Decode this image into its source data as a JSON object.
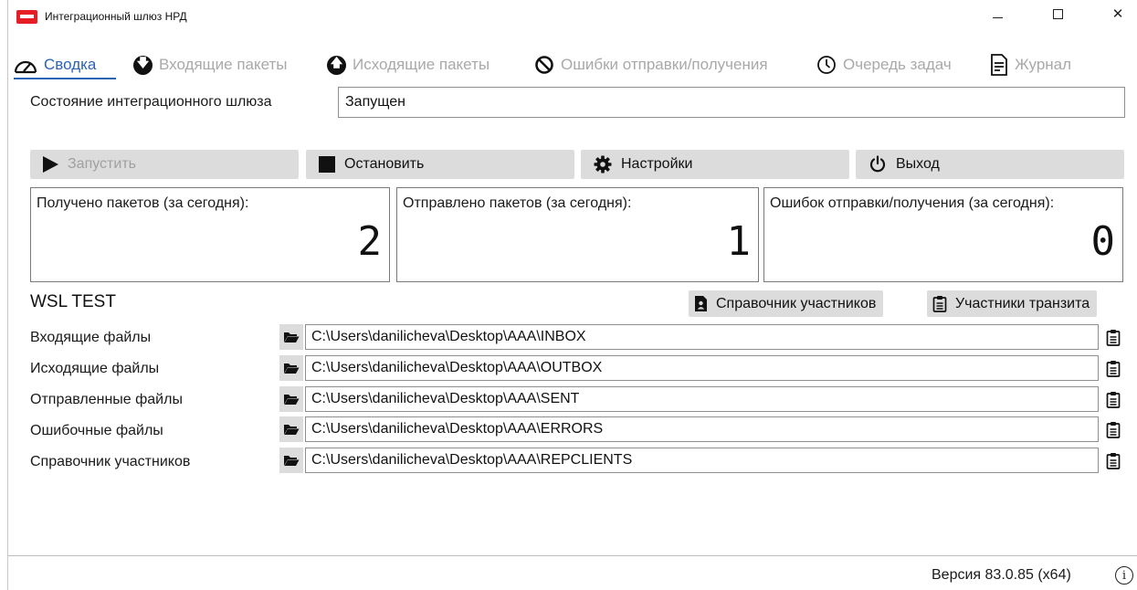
{
  "window": {
    "title": "Интеграционный шлюз НРД",
    "minimize_icon": "minimize-icon",
    "maximize_icon": "maximize-icon",
    "close_glyph": "✕"
  },
  "tabs": [
    {
      "label": "Сводка",
      "icon": "gauge-icon",
      "active": true
    },
    {
      "label": "Входящие пакеты",
      "icon": "arrow-down-circle-icon",
      "active": false
    },
    {
      "label": "Исходящие пакеты",
      "icon": "arrow-up-circle-icon",
      "active": false
    },
    {
      "label": "Ошибки отправки/получения",
      "icon": "ban-icon",
      "active": false
    },
    {
      "label": "Очередь задач",
      "icon": "clock-icon",
      "active": false
    },
    {
      "label": "Журнал",
      "icon": "document-icon",
      "active": false
    }
  ],
  "status": {
    "label": "Состояние интеграционного шлюза",
    "value": "Запущен"
  },
  "actions": {
    "start": "Запустить",
    "stop": "Остановить",
    "settings": "Настройки",
    "exit": "Выход"
  },
  "stats": [
    {
      "label": "Получено пакетов (за сегодня):",
      "value": "2"
    },
    {
      "label": "Отправлено пакетов (за сегодня):",
      "value": "1"
    },
    {
      "label": "Ошибок отправки/получения (за сегодня):",
      "value": "0"
    }
  ],
  "section": {
    "title": "WSL TEST",
    "directory_button": "Справочник участников",
    "transit_button": "Участники транзита"
  },
  "folders": [
    {
      "label": "Входящие файлы",
      "path": "C:\\Users\\danilicheva\\Desktop\\AAA\\INBOX"
    },
    {
      "label": "Исходящие файлы",
      "path": "C:\\Users\\danilicheva\\Desktop\\AAA\\OUTBOX"
    },
    {
      "label": "Отправленные файлы",
      "path": "C:\\Users\\danilicheva\\Desktop\\AAA\\SENT"
    },
    {
      "label": "Ошибочные файлы",
      "path": "C:\\Users\\danilicheva\\Desktop\\AAA\\ERRORS"
    },
    {
      "label": "Справочник участников",
      "path": "C:\\Users\\danilicheva\\Desktop\\AAA\\REPCLIENTS"
    }
  ],
  "footer": {
    "version": "Версия 83.0.85 (x64)",
    "info_glyph": "i"
  },
  "colors": {
    "accent": "#2b63b6",
    "brand_red": "#e51e25",
    "button_bg": "#dcdcdc",
    "inactive_tab": "#a9a9a9"
  }
}
